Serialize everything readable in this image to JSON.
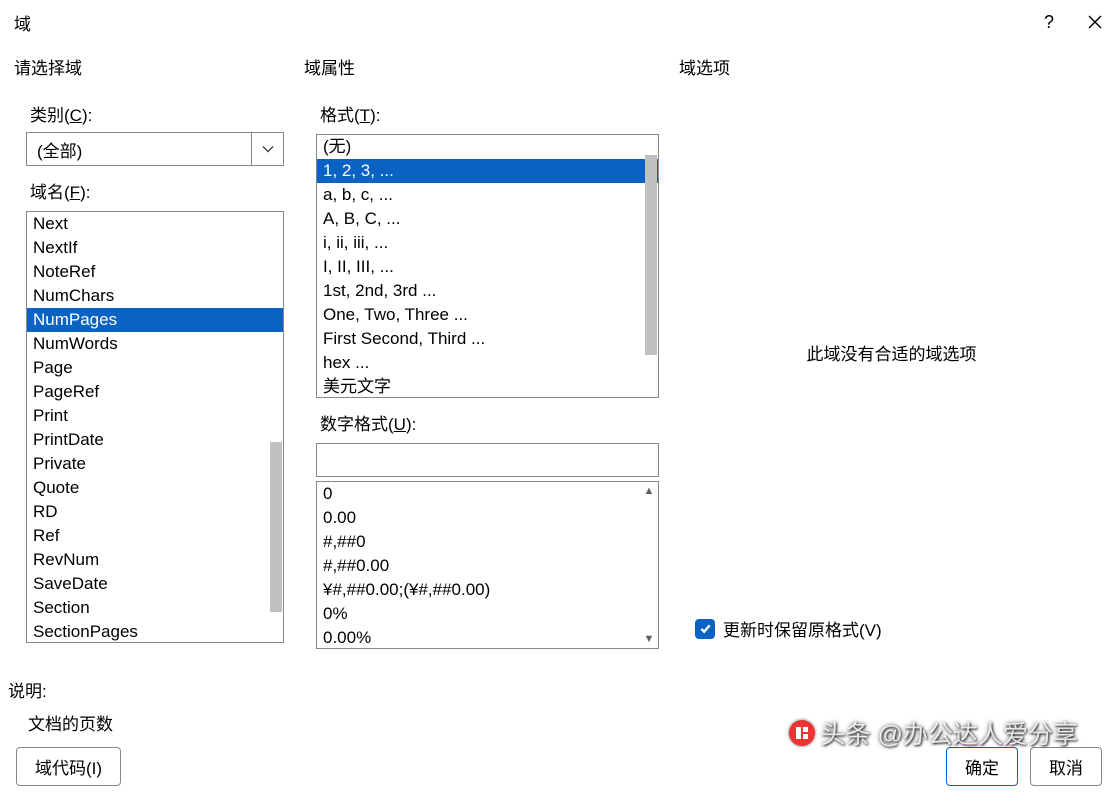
{
  "dialog": {
    "title": "域",
    "help_glyph": "?",
    "panel_left_title": "请选择域",
    "panel_mid_title": "域属性",
    "panel_right_title": "域选项",
    "category_label_pre": "类别(",
    "category_label_u": "C",
    "category_label_post": "):",
    "category_value": "(全部)",
    "fieldname_label_pre": "域名(",
    "fieldname_label_u": "F",
    "fieldname_label_post": "):",
    "field_names": [
      "Next",
      "NextIf",
      "NoteRef",
      "NumChars",
      "NumPages",
      "NumWords",
      "Page",
      "PageRef",
      "Print",
      "PrintDate",
      "Private",
      "Quote",
      "RD",
      "Ref",
      "RevNum",
      "SaveDate",
      "Section",
      "SectionPages"
    ],
    "field_selected": "NumPages",
    "format_label_pre": "格式(",
    "format_label_u": "T",
    "format_label_post": "):",
    "formats": [
      "(无)",
      "1, 2, 3, ...",
      "a, b, c, ...",
      "A, B, C, ...",
      "i, ii, iii, ...",
      "I, II, III, ...",
      "1st, 2nd, 3rd ...",
      "One, Two, Three ...",
      "First Second, Third ...",
      "hex ...",
      "美元文字"
    ],
    "format_selected": "1, 2, 3, ...",
    "numformat_label_pre": "数字格式(",
    "numformat_label_u": "U",
    "numformat_label_post": "):",
    "numformat_value": "",
    "num_formats": [
      "0",
      "0.00",
      "#,##0",
      "#,##0.00",
      "¥#,##0.00;(¥#,##0.00)",
      "0%",
      "0.00%"
    ],
    "no_options_text": "此域没有合适的域选项",
    "preserve_label_pre": "更新时保留原格式(",
    "preserve_label_u": "V",
    "preserve_label_post": ")",
    "desc_label": "说明:",
    "desc_text": "文档的页数",
    "fieldcode_btn_pre": "域代码(",
    "fieldcode_btn_u": "I",
    "fieldcode_btn_post": ")",
    "ok_btn": "确定",
    "cancel_btn": "取消"
  },
  "watermark": {
    "text": "头条 @办公达人爱分享"
  }
}
